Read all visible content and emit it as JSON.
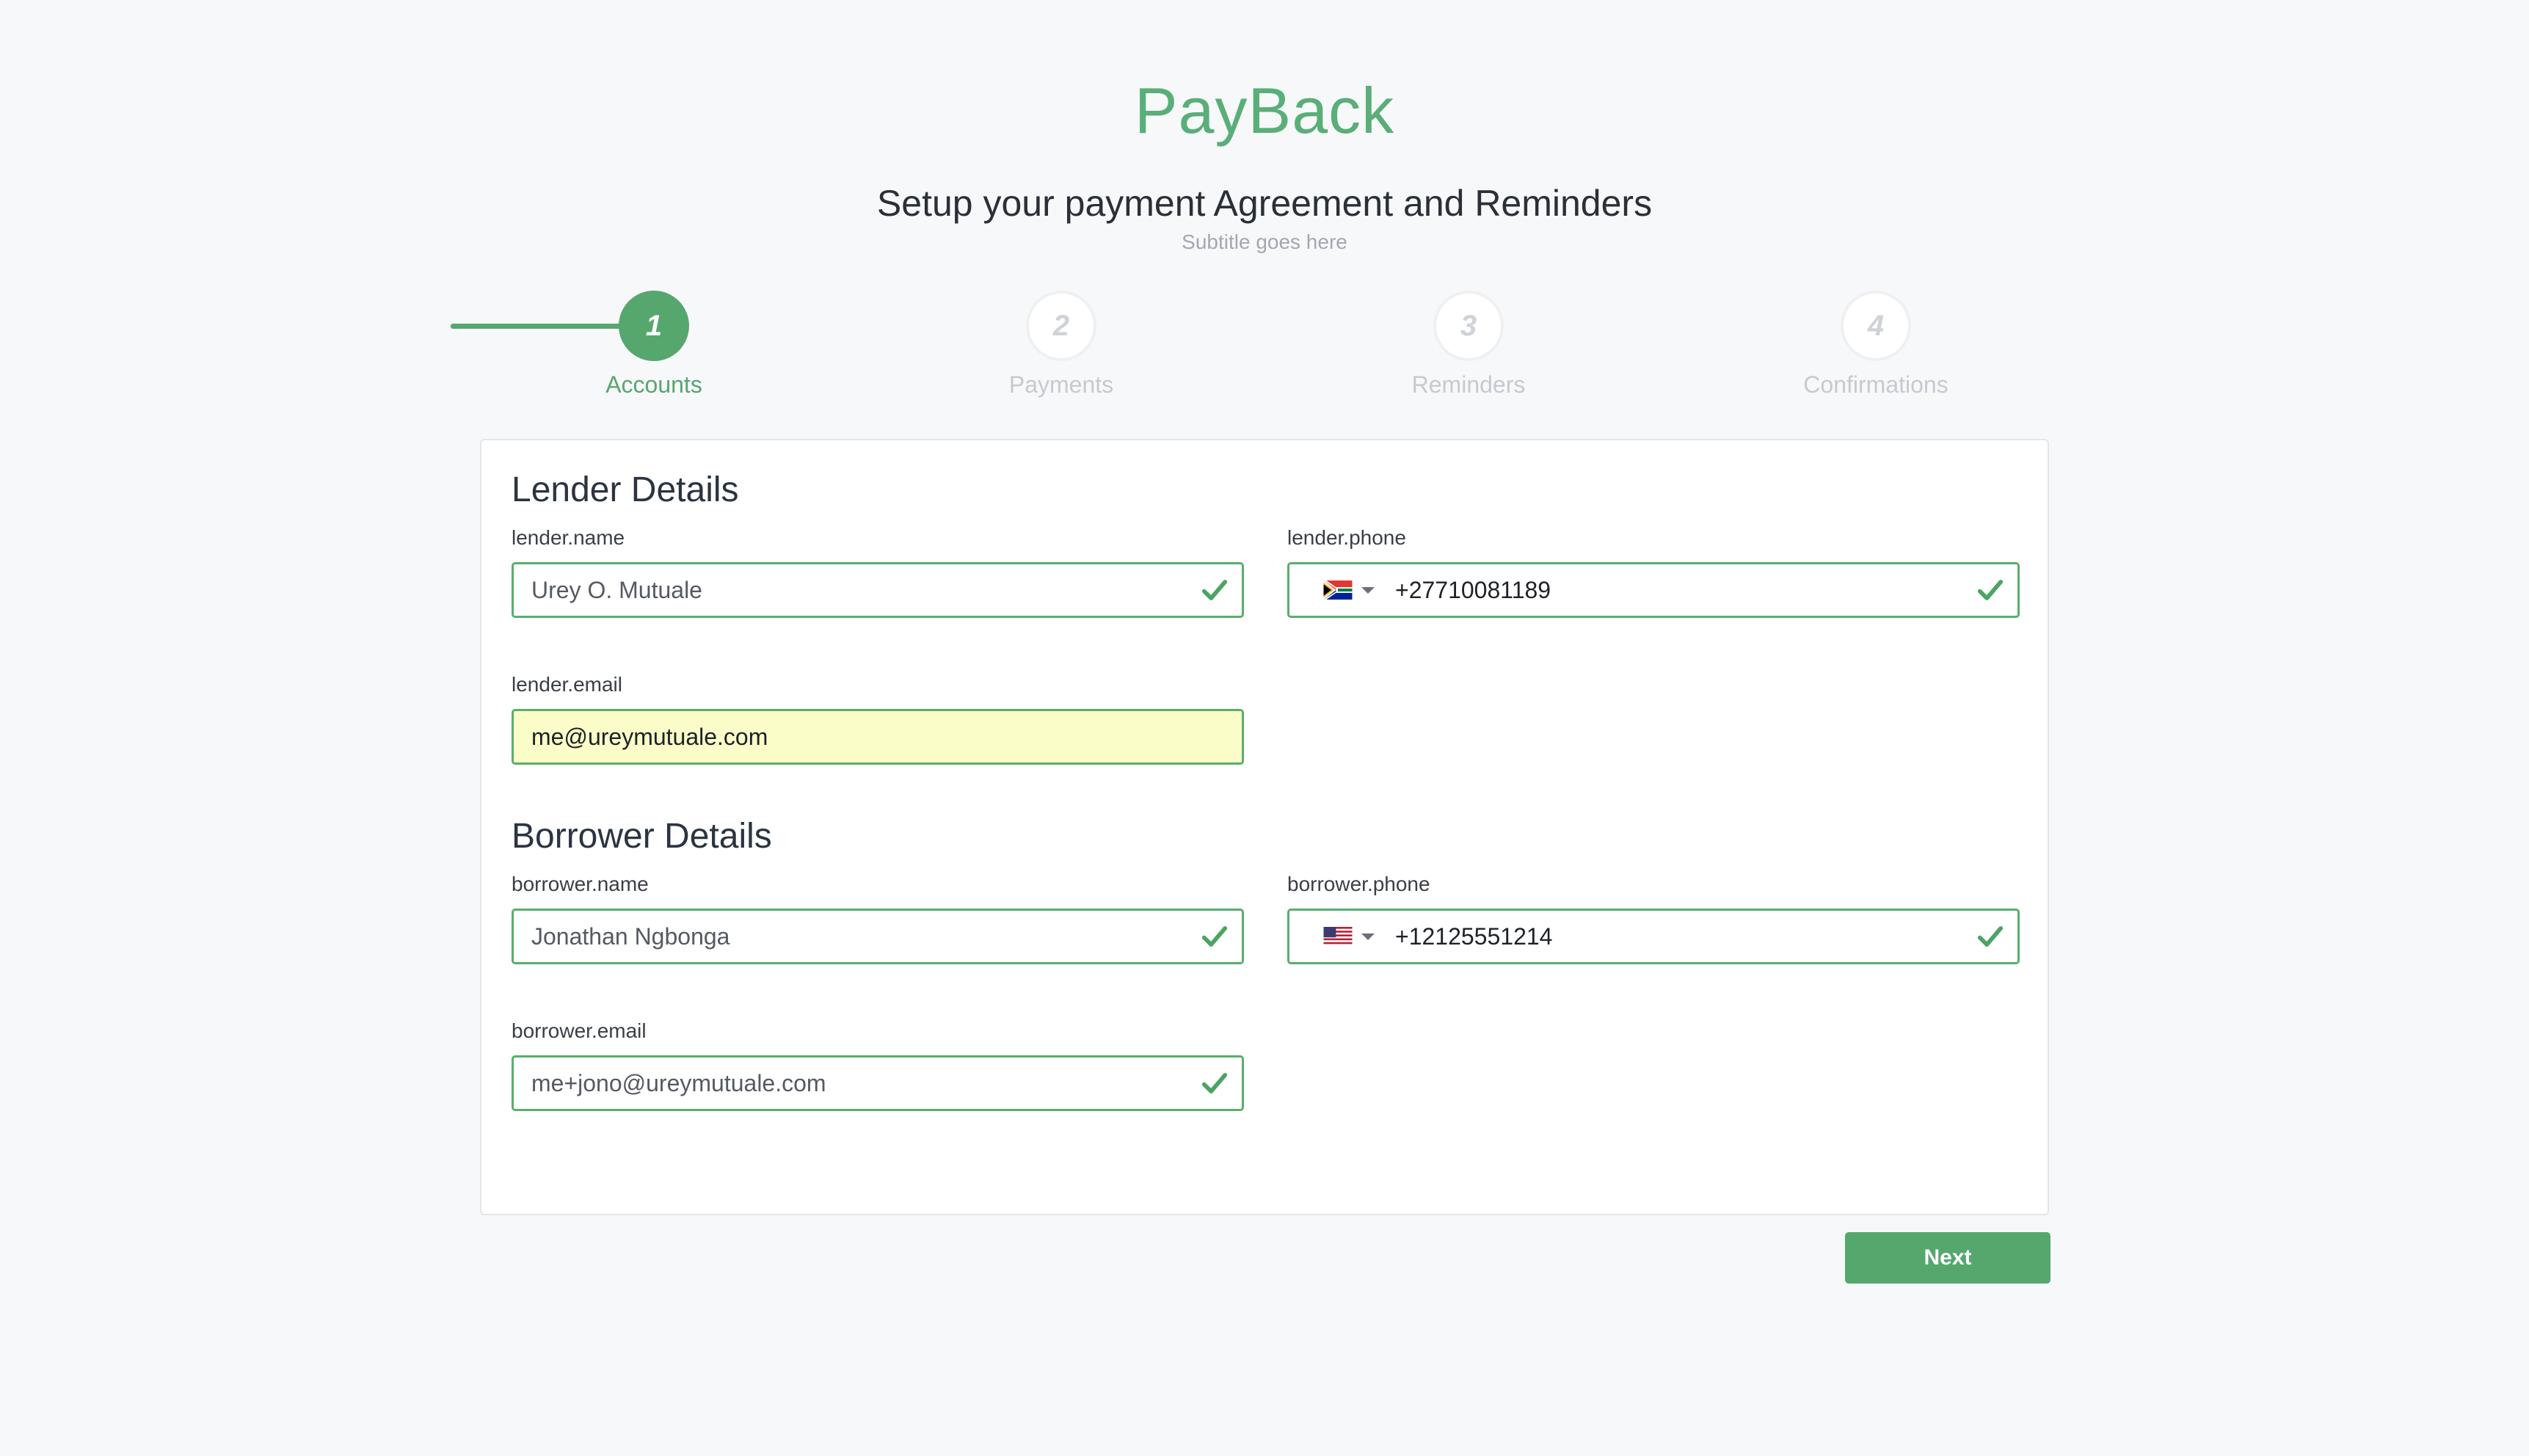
{
  "app": {
    "brand": "PayBack",
    "headline": "Setup your payment Agreement and Reminders",
    "subtitle": "Subtitle goes here"
  },
  "stepper": {
    "steps": [
      {
        "number": "1",
        "label": "Accounts",
        "state": "active"
      },
      {
        "number": "2",
        "label": "Payments",
        "state": "inactive"
      },
      {
        "number": "3",
        "label": "Reminders",
        "state": "inactive"
      },
      {
        "number": "4",
        "label": "Confirmations",
        "state": "inactive"
      }
    ]
  },
  "lender": {
    "title": "Lender Details",
    "name_label": "lender.name",
    "name_value": "Urey O. Mutuale",
    "phone_label": "lender.phone",
    "phone_value": "+27710081189",
    "phone_country_flag": "south-africa-flag-icon",
    "email_label": "lender.email",
    "email_value": "me@ureymutuale.com"
  },
  "borrower": {
    "title": "Borrower Details",
    "name_label": "borrower.name",
    "name_value": "Jonathan Ngbonga",
    "phone_label": "borrower.phone",
    "phone_value": "+12125551214",
    "phone_country_flag": "united-states-flag-icon",
    "email_label": "borrower.email",
    "email_value": "me+jono@ureymutuale.com"
  },
  "actions": {
    "next_label": "Next"
  },
  "colors": {
    "accent": "#56a76e",
    "valid_border": "#5aae6c",
    "autofill_background": "#fafdc7",
    "page_background": "#f7f8fa"
  }
}
